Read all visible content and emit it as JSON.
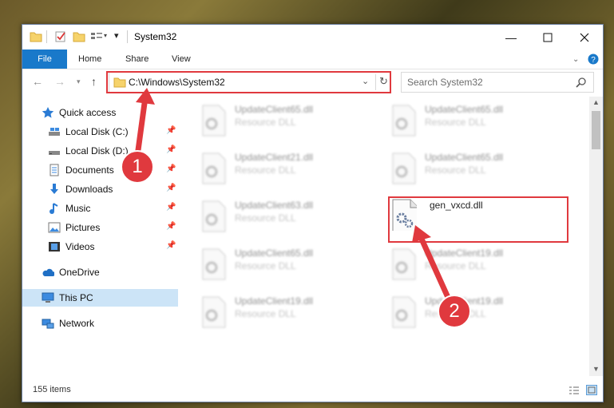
{
  "window": {
    "title": "System32"
  },
  "ribbon": {
    "file": "File",
    "home": "Home",
    "share": "Share",
    "view": "View"
  },
  "address": {
    "path": "C:\\Windows\\System32",
    "search_placeholder": "Search System32"
  },
  "nav": {
    "items": [
      {
        "label": "Quick access",
        "icon": "star-icon",
        "pinned": false
      },
      {
        "label": "Local Disk (C:)",
        "icon": "drive-icon",
        "pinned": true
      },
      {
        "label": "Local Disk (D:)",
        "icon": "drive-icon",
        "pinned": true
      },
      {
        "label": "Documents",
        "icon": "documents-icon",
        "pinned": true
      },
      {
        "label": "Downloads",
        "icon": "download-icon",
        "pinned": true
      },
      {
        "label": "Music",
        "icon": "music-icon",
        "pinned": true
      },
      {
        "label": "Pictures",
        "icon": "pictures-icon",
        "pinned": true
      },
      {
        "label": "Videos",
        "icon": "videos-icon",
        "pinned": true
      },
      {
        "label": "OneDrive",
        "icon": "cloud-icon",
        "pinned": false
      },
      {
        "label": "This PC",
        "icon": "computer-icon",
        "pinned": false,
        "selected": true
      },
      {
        "label": "Network",
        "icon": "network-icon",
        "pinned": false
      }
    ]
  },
  "files": [
    {
      "name": "UpdateClient65.dll",
      "type": "Resource DLL"
    },
    {
      "name": "UpdateClient65.dll",
      "type": "Resource DLL"
    },
    {
      "name": "UpdateClient21.dll",
      "type": "Resource DLL"
    },
    {
      "name": "UpdateClient65.dll",
      "type": "Resource DLL"
    },
    {
      "name": "UpdateClient63.dll",
      "type": "Resource DLL"
    },
    {
      "name": "gen_vxcd.dll",
      "type": ""
    },
    {
      "name": "UpdateClient65.dll",
      "type": "Resource DLL"
    },
    {
      "name": "UpdateClient19.dll",
      "type": "Resource DLL"
    },
    {
      "name": "UpdateClient19.dll",
      "type": "Resource DLL"
    },
    {
      "name": "UpdateClient19.dll",
      "type": "Resource DLL"
    }
  ],
  "status": {
    "count": "155 items"
  },
  "callouts": {
    "one": "1",
    "two": "2"
  },
  "colors": {
    "accent": "#1979ca",
    "highlight": "#e0393e",
    "selection": "#cce4f7"
  }
}
